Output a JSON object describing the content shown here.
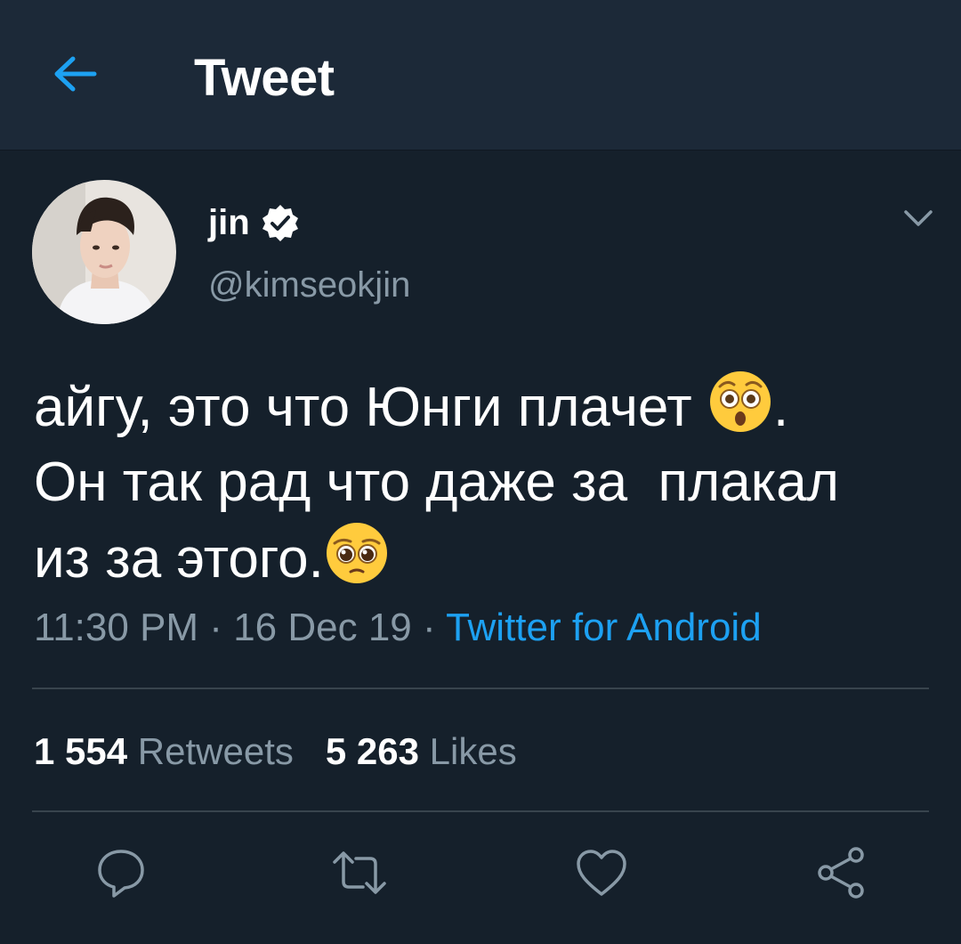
{
  "header": {
    "title": "Tweet",
    "back_icon": "arrow-left-icon",
    "accent_color": "#1da1f2"
  },
  "author": {
    "display_name": "jin",
    "handle": "@kimseokjin",
    "verified": true
  },
  "tweet": {
    "line1": "айгу, это что Юнги плачет",
    "line1_end": ".",
    "line2": "Он так рад что даже за  плакал",
    "line3": "из за этого.",
    "emoji1": "astonished-face",
    "emoji2": "pleading-face"
  },
  "meta": {
    "time": "11:30 PM",
    "sep": " · ",
    "date": "16 Dec 19",
    "source": "Twitter for Android"
  },
  "stats": {
    "retweets_count": "1 554",
    "retweets_label": "Retweets",
    "likes_count": "5 263",
    "likes_label": "Likes"
  },
  "actions": [
    "reply-icon",
    "retweet-icon",
    "like-icon",
    "share-icon"
  ]
}
